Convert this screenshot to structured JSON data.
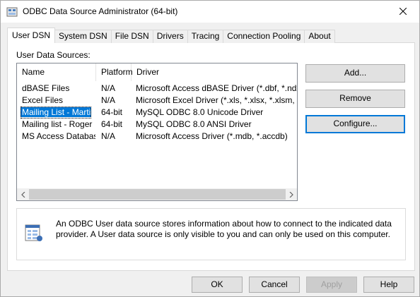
{
  "window": {
    "title": "ODBC Data Source Administrator (64-bit)"
  },
  "tabs": [
    {
      "label": "User DSN",
      "active": true
    },
    {
      "label": "System DSN"
    },
    {
      "label": "File DSN"
    },
    {
      "label": "Drivers"
    },
    {
      "label": "Tracing"
    },
    {
      "label": "Connection Pooling"
    },
    {
      "label": "About"
    }
  ],
  "list": {
    "section_label": "User Data Sources:",
    "columns": [
      "Name",
      "Platform",
      "Driver"
    ],
    "rows": [
      {
        "name": "dBASE Files",
        "platform": "N/A",
        "driver": "Microsoft Access dBASE Driver (*.dbf, *.ndx, *.m"
      },
      {
        "name": "Excel Files",
        "platform": "N/A",
        "driver": "Microsoft Excel Driver (*.xls, *.xlsx, *.xlsm, *.xlsb)"
      },
      {
        "name": "Mailing List - Martin",
        "platform": "64-bit",
        "driver": "MySQL ODBC 8.0 Unicode Driver",
        "selected": true
      },
      {
        "name": "Mailing list - Roger",
        "platform": "64-bit",
        "driver": "MySQL ODBC 8.0 ANSI Driver"
      },
      {
        "name": "MS Access Database",
        "platform": "N/A",
        "driver": "Microsoft Access Driver (*.mdb, *.accdb)"
      }
    ]
  },
  "side_buttons": {
    "add": "Add...",
    "remove": "Remove",
    "configure": "Configure..."
  },
  "info": {
    "text": "An ODBC User data source stores information about how to connect to the indicated data provider.   A User data source is only visible to you and can only be used on this computer."
  },
  "bottom_buttons": {
    "ok": "OK",
    "cancel": "Cancel",
    "apply": "Apply",
    "help": "Help"
  },
  "colors": {
    "selection": "#0078d7",
    "panel": "#ffffff",
    "window_bg": "#f0f0f0"
  }
}
